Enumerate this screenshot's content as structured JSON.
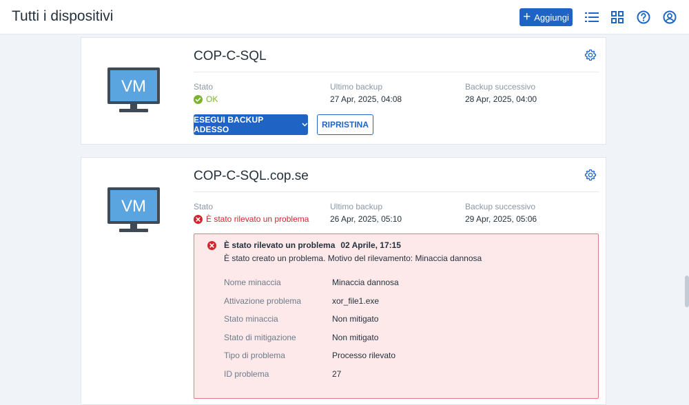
{
  "header": {
    "title": "Tutti i dispositivi",
    "add_label": "Aggiungi",
    "icons": [
      "list-view-icon",
      "grid-view-icon",
      "help-icon",
      "account-icon"
    ]
  },
  "labels": {
    "status": "Stato",
    "last_backup": "Ultimo backup",
    "next_backup": "Backup successivo"
  },
  "devices": [
    {
      "icon_text": "VM",
      "name": "COP-C-SQL",
      "status": "OK",
      "status_color": "#7ab32e",
      "last_backup": "27 Apr, 2025, 04:08",
      "next_backup": "28 Apr, 2025, 04:00",
      "backup_now_label": "ESEGUI BACKUP ADESSO",
      "restore_label": "RIPRISTINA"
    },
    {
      "icon_text": "VM",
      "name": "COP-C-SQL.cop.se",
      "status": "È stato rilevato un problema",
      "status_color": "#d2262f",
      "last_backup": "26 Apr, 2025, 05:10",
      "next_backup": "29 Apr, 2025, 05:06",
      "alert": {
        "title": "È stato rilevato un problema",
        "date": "02 Aprile, 17:15",
        "description": "È stato creato un problema. Motivo del rilevamento: Minaccia dannosa",
        "details": [
          {
            "label": "Nome minaccia",
            "value": "Minaccia dannosa"
          },
          {
            "label": "Attivazione problema",
            "value": "xor_file1.exe"
          },
          {
            "label": "Stato minaccia",
            "value": "Non mitigato"
          },
          {
            "label": "Stato di mitigazione",
            "value": "Non mitigato"
          },
          {
            "label": "Tipo di problema",
            "value": "Processo rilevato"
          },
          {
            "label": "ID problema",
            "value": "27"
          }
        ]
      }
    }
  ],
  "colors": {
    "accent": "#1f64c4",
    "ok": "#7ab32e",
    "error": "#d2262f",
    "alert_bg": "#fde9ea",
    "alert_border": "#e57b80",
    "monitor_screen": "#5aa5e0",
    "monitor_frame": "#3f4a55"
  }
}
